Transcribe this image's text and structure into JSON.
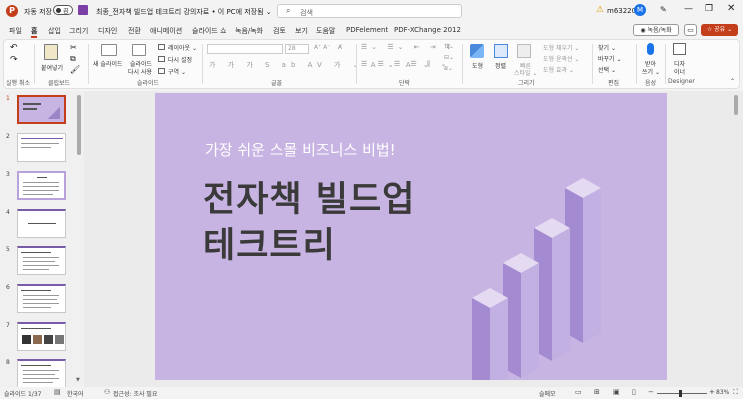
{
  "titlebar": {
    "autosave_label": "자동 저장",
    "autosave_state": "끔",
    "doc_title": "최종_전자책 빌드업 테크트리 강의자료 • 이 PC에 저장됨 ⌄",
    "search_placeholder": "검색",
    "user_name": "m63220",
    "avatar_initial": "M"
  },
  "menu": {
    "items": [
      "파일",
      "홈",
      "삽입",
      "그리기",
      "디자인",
      "전환",
      "애니메이션",
      "슬라이드 쇼",
      "녹음/녹화",
      "검토",
      "보기",
      "도움말",
      "PDFelement",
      "PDF-XChange 2012"
    ],
    "record_button": "◉ 녹음/녹화",
    "share_button": "☆ 공유 ⌄"
  },
  "ribbon": {
    "groups": {
      "undo": "실행 취소",
      "clipboard": "클립보드",
      "slides": "슬라이드",
      "font": "글꼴",
      "paragraph": "단락",
      "drawing": "그리기",
      "editing": "편집",
      "voice": "음성",
      "designer": "Designer"
    },
    "paste": "붙여넣기",
    "new_slide": "새 슬라이드",
    "reuse_slide_1": "슬라이드",
    "reuse_slide_2": "다시 사용",
    "layout": "레이아웃 ⌄",
    "reset": "다시 설정",
    "section": "구역 ⌄",
    "font_size": "28",
    "shapes": "도형",
    "arrange": "정렬",
    "quick_styles_1": "빠른",
    "quick_styles_2": "스타일 ⌄",
    "shape_fill": "도형 채우기 ⌄",
    "shape_outline": "도형 윤곽선 ⌄",
    "shape_effects": "도형 효과 ⌄",
    "find": "찾기 ⌄",
    "replace": "바꾸기 ⌄",
    "select": "선택 ⌄",
    "dictate_1": "받아",
    "dictate_2": "쓰기 ⌄",
    "designer_1": "디자",
    "designer_2": "이너"
  },
  "slide": {
    "subtitle": "가장 쉬운 스몰 비즈니스 비법!",
    "title_line1": "전자책 빌드업",
    "title_line2": "테크트리"
  },
  "thumbnails": {
    "numbers": [
      "1",
      "2",
      "3",
      "4",
      "5",
      "6",
      "7",
      "8"
    ]
  },
  "status": {
    "slide_count": "슬라이드 1/37",
    "language": "한국어",
    "accessibility": "접근성: 조사 필요",
    "notes": "슬메모",
    "zoom": "83%"
  },
  "colors": {
    "slide_bg": "#c8b4e2",
    "title_text": "#3a3a3a",
    "accent_red": "#c43e1c",
    "avatar_blue": "#1a73e8"
  }
}
